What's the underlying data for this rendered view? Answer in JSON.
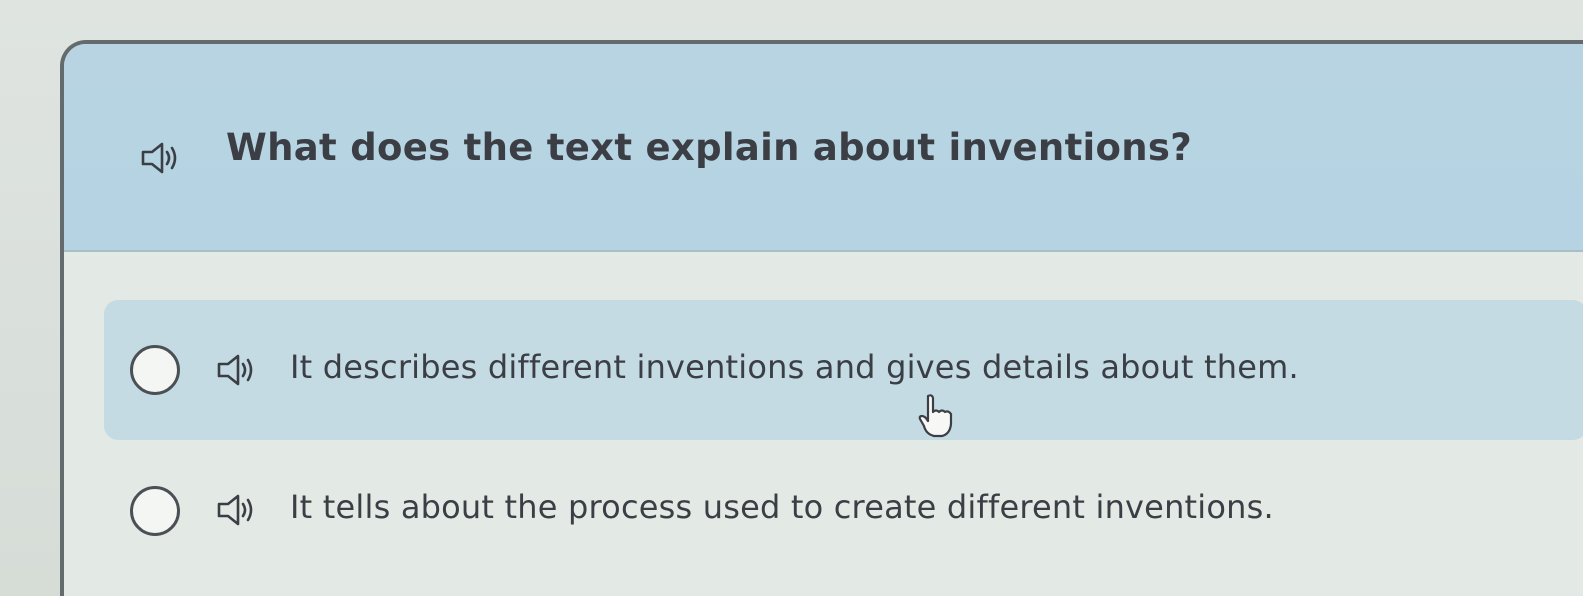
{
  "question": {
    "text": "What does the text explain about inventions?",
    "audio_icon": "speaker-icon"
  },
  "answers": [
    {
      "text": "It describes different inventions and gives details about them.",
      "selected": false,
      "hovered": true,
      "audio_icon": "speaker-icon"
    },
    {
      "text": "It tells about the process used to create different inventions.",
      "selected": false,
      "hovered": false,
      "audio_icon": "speaker-icon"
    }
  ],
  "cursor_icon": "hand-pointer-icon",
  "colors": {
    "question_band": "#b8d4e2",
    "answer_hover": "#c4dbe3",
    "text": "#3b3f45"
  }
}
